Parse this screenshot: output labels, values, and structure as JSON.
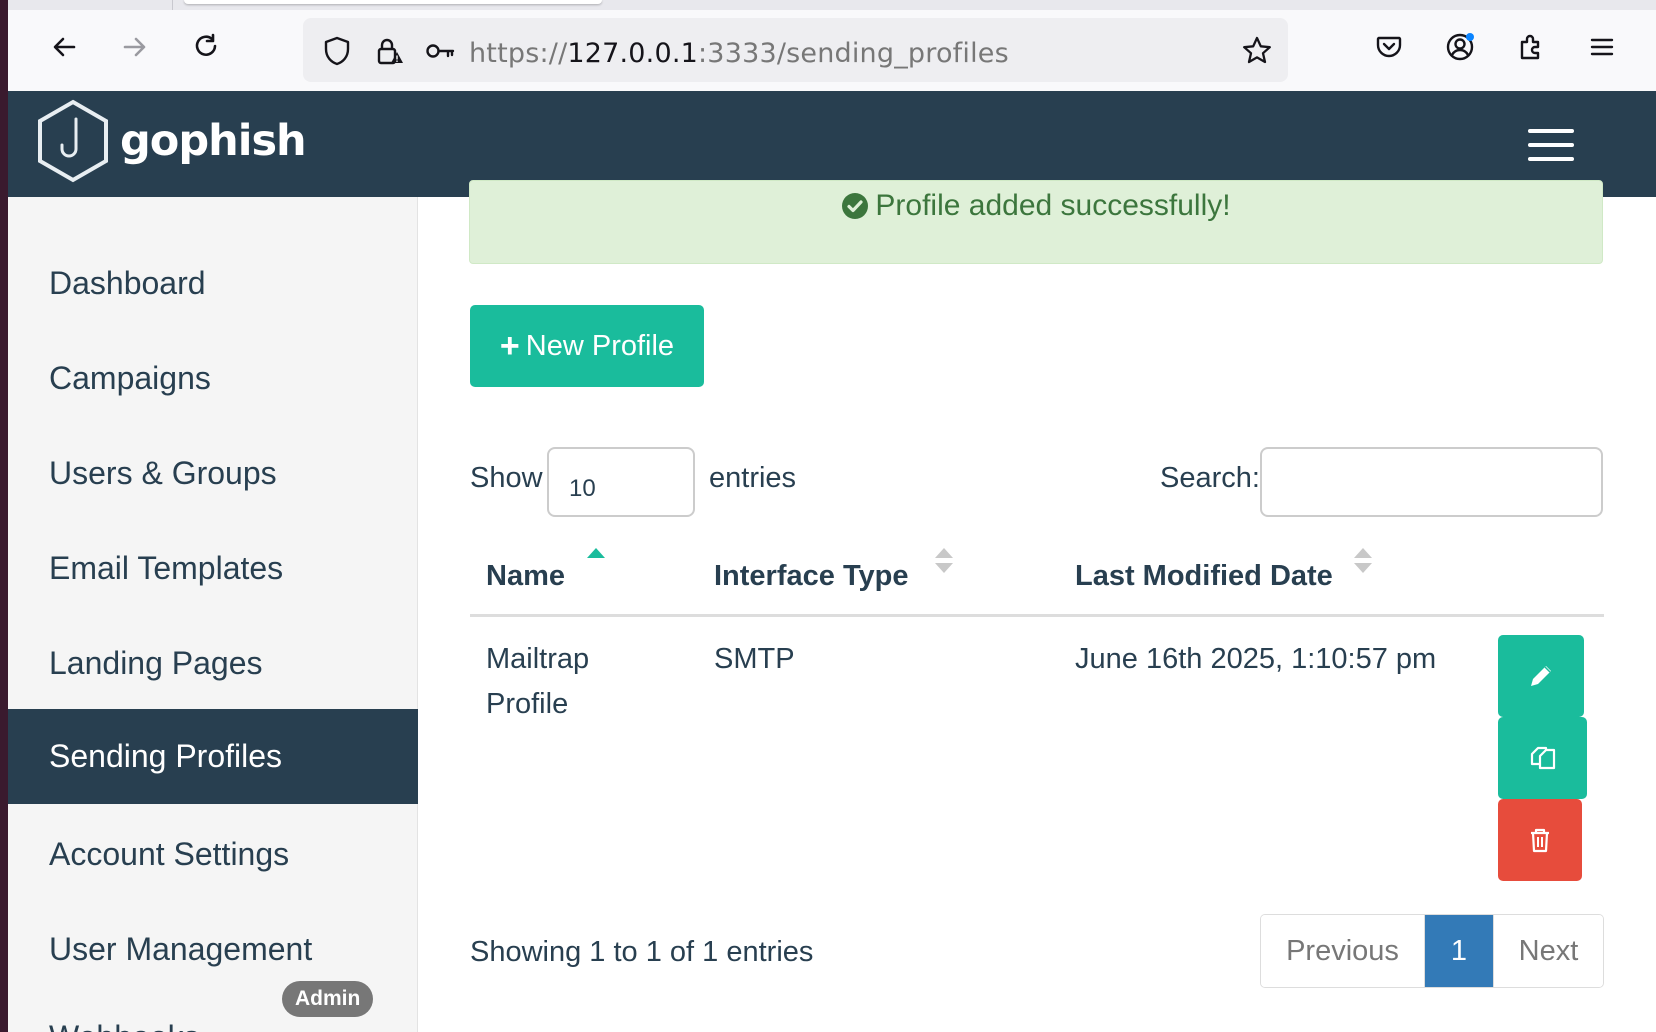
{
  "browser": {
    "url_scheme": "https://",
    "url_host": "127.0.0.1",
    "url_path": ":3333/sending_profiles"
  },
  "navbar": {
    "brand": "gophish",
    "accent": "#283f50"
  },
  "sidebar": {
    "items": [
      {
        "label": "Dashboard"
      },
      {
        "label": "Campaigns"
      },
      {
        "label": "Users & Groups"
      },
      {
        "label": "Email Templates"
      },
      {
        "label": "Landing Pages"
      },
      {
        "label": "Sending Profiles",
        "active": true
      },
      {
        "label": "Account Settings"
      },
      {
        "label": "User Management"
      }
    ],
    "admin_badge": "Admin",
    "cut_item": "Webhooks"
  },
  "alert": {
    "message": "Profile added successfully!",
    "color": "#3c763d"
  },
  "toolbar": {
    "new_profile_label": "New Profile"
  },
  "table_controls": {
    "show_label": "Show",
    "entries_value": "10",
    "entries_label": "entries",
    "search_label": "Search:",
    "search_value": ""
  },
  "table": {
    "headers": [
      "Name",
      "Interface Type",
      "Last Modified Date"
    ],
    "rows": [
      {
        "name_line1": "Mailtrap",
        "name_line2": "Profile",
        "interface_type": "SMTP",
        "last_modified": "June 16th 2025, 1:10:57 pm"
      }
    ]
  },
  "footer": {
    "info": "Showing 1 to 1 of 1 entries",
    "previous": "Previous",
    "current_page": "1",
    "next": "Next"
  }
}
